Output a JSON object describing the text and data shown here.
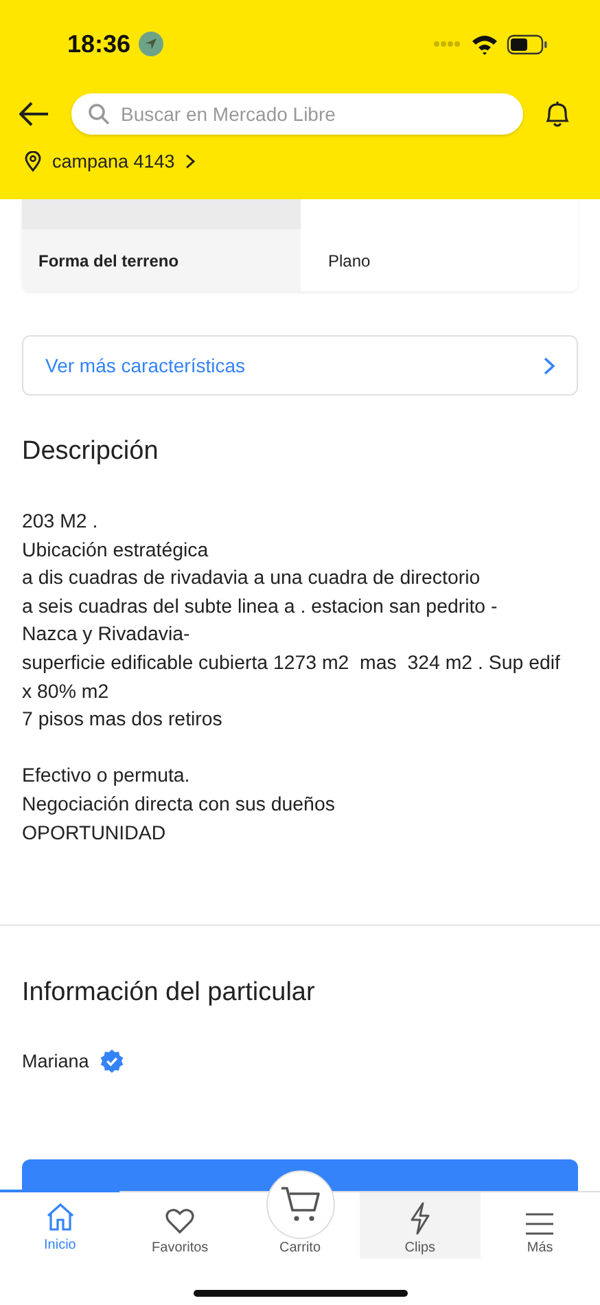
{
  "status_bar": {
    "time": "18:36"
  },
  "header": {
    "search": {
      "placeholder": "Buscar en Mercado Libre"
    },
    "location": "campana 4143"
  },
  "specs": {
    "rows": [
      {
        "label": "Forma del terreno",
        "value": "Plano"
      }
    ]
  },
  "more_link": "Ver más características",
  "description": {
    "title": "Descripción",
    "paragraphs": [
      [
        "203 M2 .",
        "Ubicación estratégica",
        "a dis cuadras de rivadavia a una cuadra de directorio",
        "a seis cuadras del subte linea a . estacion san pedrito -",
        "Nazca y Rivadavia-",
        "superficie edificable cubierta 1273 m2  mas  324 m2 . Sup edif x 80% m2",
        "7 pisos mas dos retiros"
      ],
      [
        "Efectivo o permuta.",
        "Negociación directa con sus dueños",
        "OPORTUNIDAD"
      ]
    ]
  },
  "seller": {
    "title": "Información del particular",
    "name": "Mariana",
    "verified": true
  },
  "tab_bar": [
    {
      "label": "Inicio",
      "selected": true
    },
    {
      "label": "Favoritos",
      "selected": false
    },
    {
      "label": "Carrito",
      "selected": false
    },
    {
      "label": "Clips",
      "selected": false
    },
    {
      "label": "Más",
      "selected": false
    }
  ]
}
